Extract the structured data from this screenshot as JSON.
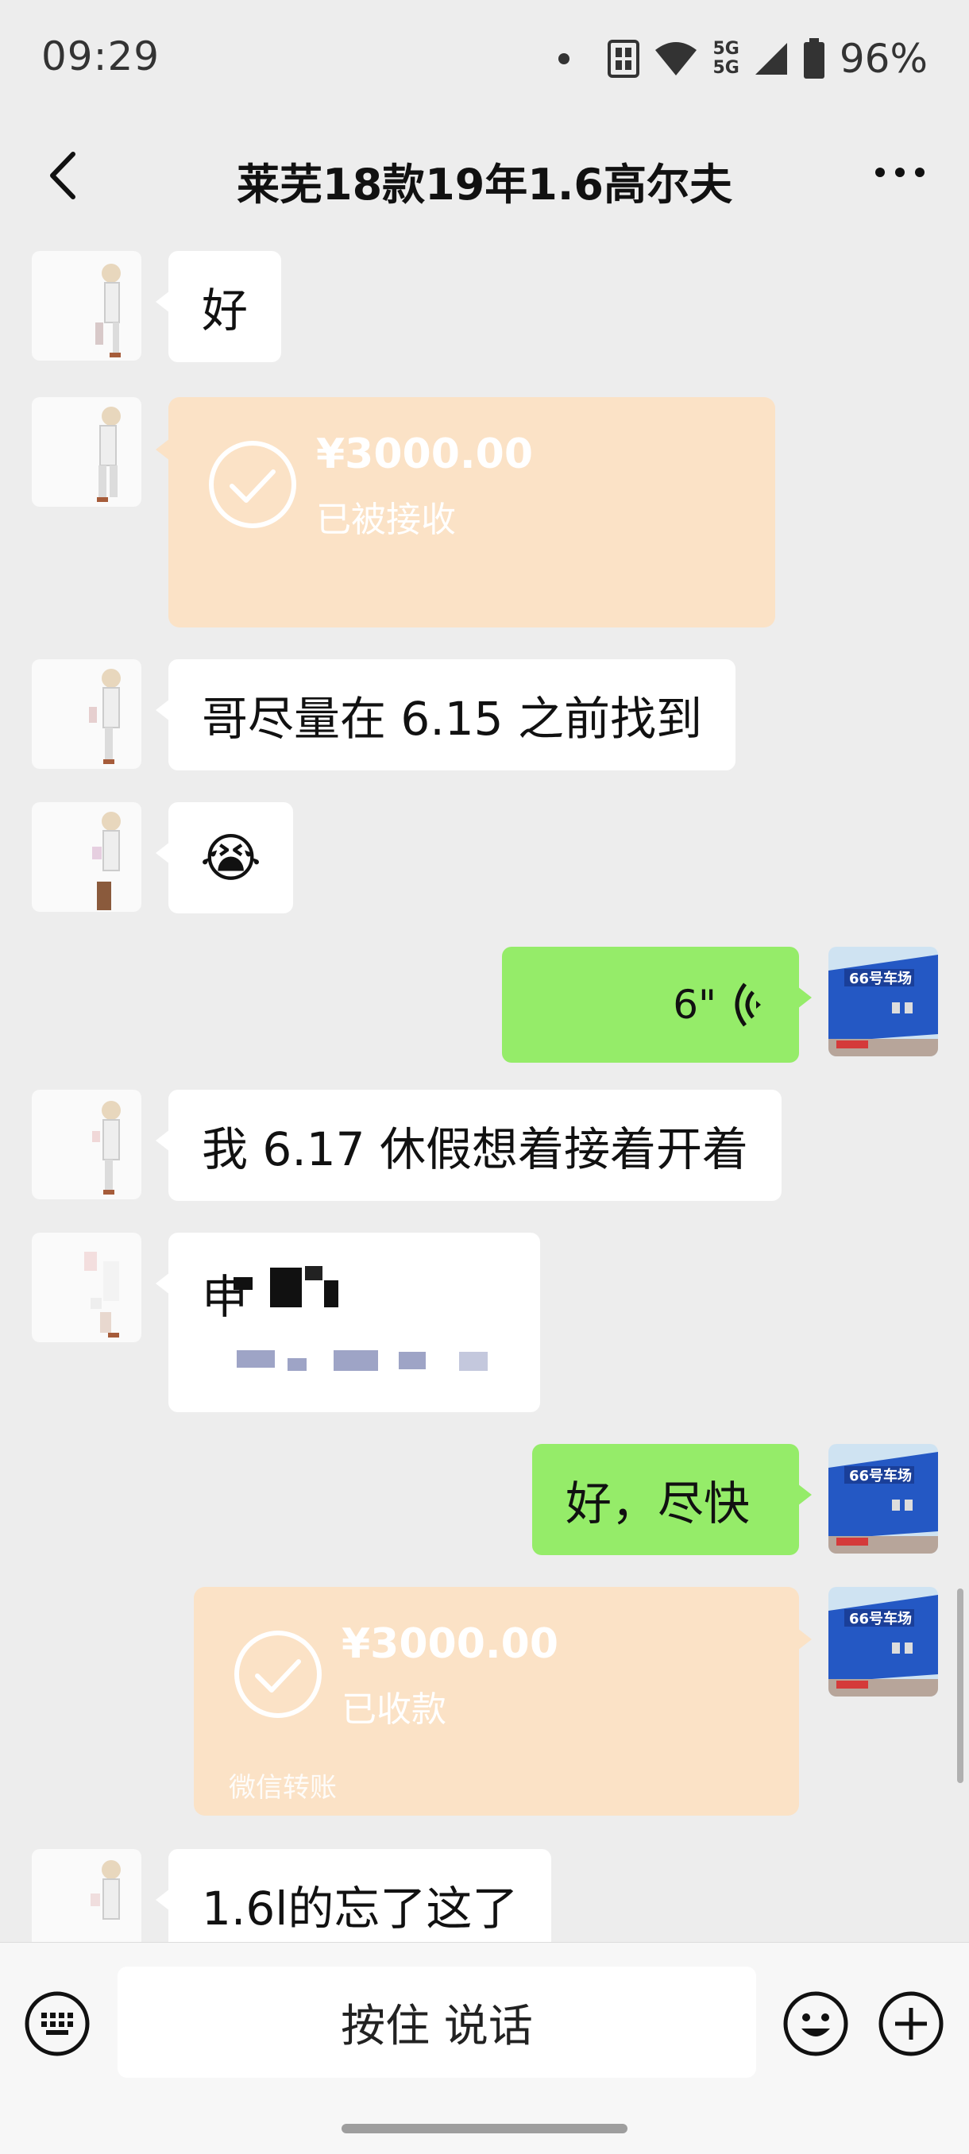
{
  "status_bar": {
    "time": "09:29",
    "network_label_top": "5G",
    "network_label_bottom": "5G",
    "battery": "96%"
  },
  "header": {
    "title": "莱芜18款19年1.6高尔夫"
  },
  "messages": {
    "m1": {
      "text": "好"
    },
    "m2": {
      "amount": "¥3000.00",
      "status": "已被接收",
      "footer": ""
    },
    "m3": {
      "text": "哥尽量在 6.15 之前找到"
    },
    "m4": {
      "emoji": "😭"
    },
    "m5": {
      "duration": "6\""
    },
    "m6": {
      "text": "我 6.17 休假想着接着开着"
    },
    "m7": {
      "text": "申"
    },
    "m8": {
      "text": "好，尽快"
    },
    "m9": {
      "amount": "¥3000.00",
      "status": "已收款",
      "footer": "微信转账"
    },
    "m10": {
      "text": "1.6l的忘了这了"
    }
  },
  "avatars": {
    "right_sign_text": "66号车场"
  },
  "input_bar": {
    "hold_to_talk": "按住 说话"
  },
  "colors": {
    "background": "#ededed",
    "green_bubble": "#95ec69",
    "transfer_bubble": "#fbe2c6"
  }
}
